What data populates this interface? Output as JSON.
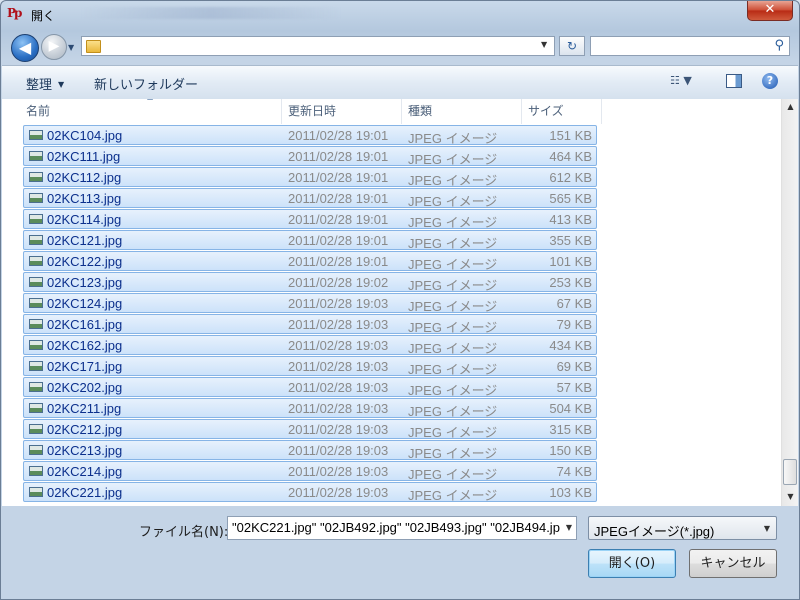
{
  "window": {
    "title": "開く",
    "app_icon": "pp-app-icon"
  },
  "controls": {
    "close_glyph": "✕"
  },
  "nav": {
    "back_glyph": "◀",
    "forward_glyph": "▶",
    "address_value": "",
    "search_placeholder": ""
  },
  "toolbar": {
    "organize_label": "整理",
    "new_folder_label": "新しいフォルダー"
  },
  "columns": {
    "name": "名前",
    "date": "更新日時",
    "type": "種類",
    "size": "サイズ"
  },
  "files": [
    {
      "name": "02KC104.jpg",
      "date": "2011/02/28 19:01",
      "type": "JPEG イメージ",
      "size": "151 KB"
    },
    {
      "name": "02KC111.jpg",
      "date": "2011/02/28 19:01",
      "type": "JPEG イメージ",
      "size": "464 KB"
    },
    {
      "name": "02KC112.jpg",
      "date": "2011/02/28 19:01",
      "type": "JPEG イメージ",
      "size": "612 KB"
    },
    {
      "name": "02KC113.jpg",
      "date": "2011/02/28 19:01",
      "type": "JPEG イメージ",
      "size": "565 KB"
    },
    {
      "name": "02KC114.jpg",
      "date": "2011/02/28 19:01",
      "type": "JPEG イメージ",
      "size": "413 KB"
    },
    {
      "name": "02KC121.jpg",
      "date": "2011/02/28 19:01",
      "type": "JPEG イメージ",
      "size": "355 KB"
    },
    {
      "name": "02KC122.jpg",
      "date": "2011/02/28 19:01",
      "type": "JPEG イメージ",
      "size": "101 KB"
    },
    {
      "name": "02KC123.jpg",
      "date": "2011/02/28 19:02",
      "type": "JPEG イメージ",
      "size": "253 KB"
    },
    {
      "name": "02KC124.jpg",
      "date": "2011/02/28 19:03",
      "type": "JPEG イメージ",
      "size": "67 KB"
    },
    {
      "name": "02KC161.jpg",
      "date": "2011/02/28 19:03",
      "type": "JPEG イメージ",
      "size": "79 KB"
    },
    {
      "name": "02KC162.jpg",
      "date": "2011/02/28 19:03",
      "type": "JPEG イメージ",
      "size": "434 KB"
    },
    {
      "name": "02KC171.jpg",
      "date": "2011/02/28 19:03",
      "type": "JPEG イメージ",
      "size": "69 KB"
    },
    {
      "name": "02KC202.jpg",
      "date": "2011/02/28 19:03",
      "type": "JPEG イメージ",
      "size": "57 KB"
    },
    {
      "name": "02KC211.jpg",
      "date": "2011/02/28 19:03",
      "type": "JPEG イメージ",
      "size": "504 KB"
    },
    {
      "name": "02KC212.jpg",
      "date": "2011/02/28 19:03",
      "type": "JPEG イメージ",
      "size": "315 KB"
    },
    {
      "name": "02KC213.jpg",
      "date": "2011/02/28 19:03",
      "type": "JPEG イメージ",
      "size": "150 KB"
    },
    {
      "name": "02KC214.jpg",
      "date": "2011/02/28 19:03",
      "type": "JPEG イメージ",
      "size": "74 KB"
    },
    {
      "name": "02KC221.jpg",
      "date": "2011/02/28 19:03",
      "type": "JPEG イメージ",
      "size": "103 KB"
    }
  ],
  "footer": {
    "filename_label": "ファイル名(N):",
    "filename_value": "\"02KC221.jpg\" \"02JB492.jpg\" \"02JB493.jpg\" \"02JB494.jp",
    "filetype_value": "JPEGイメージ(*.jpg)",
    "open_label": "開く(O)",
    "cancel_label": "キャンセル"
  },
  "colors": {
    "selection_fill": "#cce2fa",
    "selection_border": "#86b4e6",
    "filename_text": "#0b2f8c"
  },
  "icons": [
    "back-arrow-icon",
    "forward-arrow-icon",
    "folder-icon",
    "refresh-icon",
    "search-icon",
    "view-options-icon",
    "preview-pane-icon",
    "help-icon",
    "jpeg-image-icon"
  ]
}
